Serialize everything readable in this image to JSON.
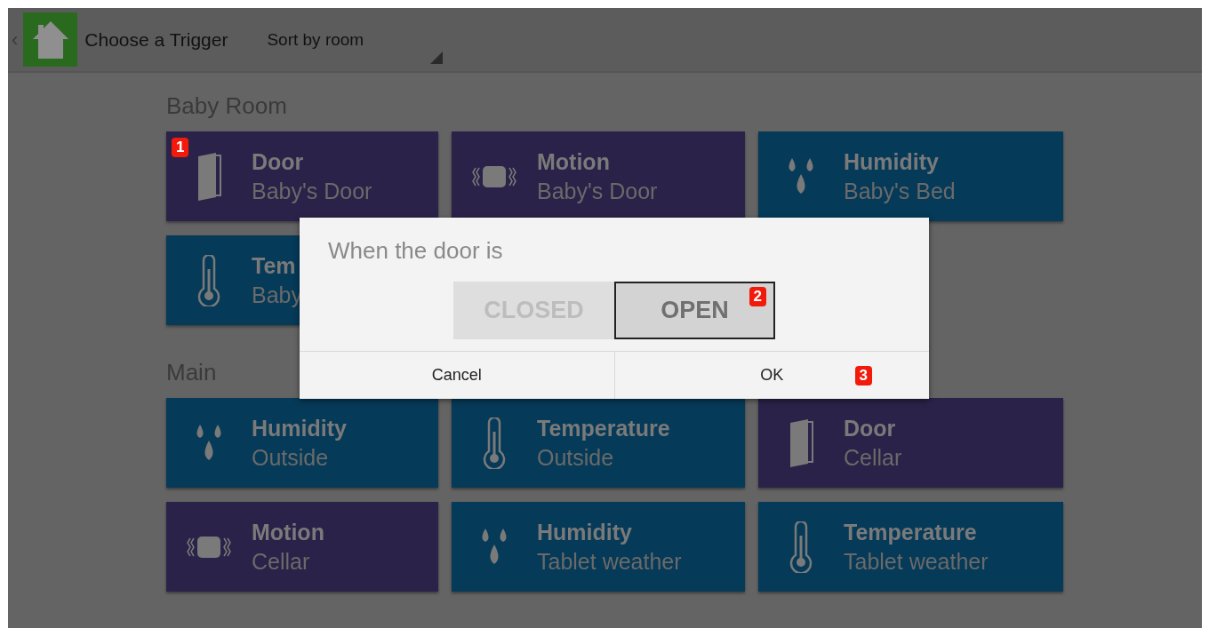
{
  "top_bar": {
    "back": "‹",
    "title": "Choose a Trigger",
    "sort": "Sort by room"
  },
  "sections": [
    {
      "name": "Baby Room",
      "tiles": [
        {
          "kind": "door",
          "color": "#2a2248",
          "title": "Door",
          "subtitle": "Baby's Door",
          "badge": "1"
        },
        {
          "kind": "motion",
          "color": "#2a2248",
          "title": "Motion",
          "subtitle": "Baby's Door"
        },
        {
          "kind": "humidity",
          "color": "#053a58",
          "title": "Humidity",
          "subtitle": "Baby's Bed"
        },
        {
          "kind": "temperature",
          "color": "#053a58",
          "title": "Tem",
          "subtitle": "Baby"
        }
      ]
    },
    {
      "name": "Main",
      "tiles": [
        {
          "kind": "humidity",
          "color": "#053a58",
          "title": "Humidity",
          "subtitle": "Outside"
        },
        {
          "kind": "temperature",
          "color": "#053a58",
          "title": "Temperature",
          "subtitle": "Outside"
        },
        {
          "kind": "door",
          "color": "#2a2248",
          "title": "Door",
          "subtitle": "Cellar"
        },
        {
          "kind": "motion",
          "color": "#2a2248",
          "title": "Motion",
          "subtitle": "Cellar"
        },
        {
          "kind": "humidity",
          "color": "#053a58",
          "title": "Humidity",
          "subtitle": "Tablet weather"
        },
        {
          "kind": "temperature",
          "color": "#053a58",
          "title": "Temperature",
          "subtitle": "Tablet weather"
        }
      ]
    }
  ],
  "dialog": {
    "title": "When the door is",
    "options": [
      {
        "label": "CLOSED",
        "selected": false
      },
      {
        "label": "OPEN",
        "selected": true,
        "badge": "2"
      }
    ],
    "buttons": [
      {
        "label": "Cancel"
      },
      {
        "label": "OK",
        "badge": "3"
      }
    ]
  }
}
